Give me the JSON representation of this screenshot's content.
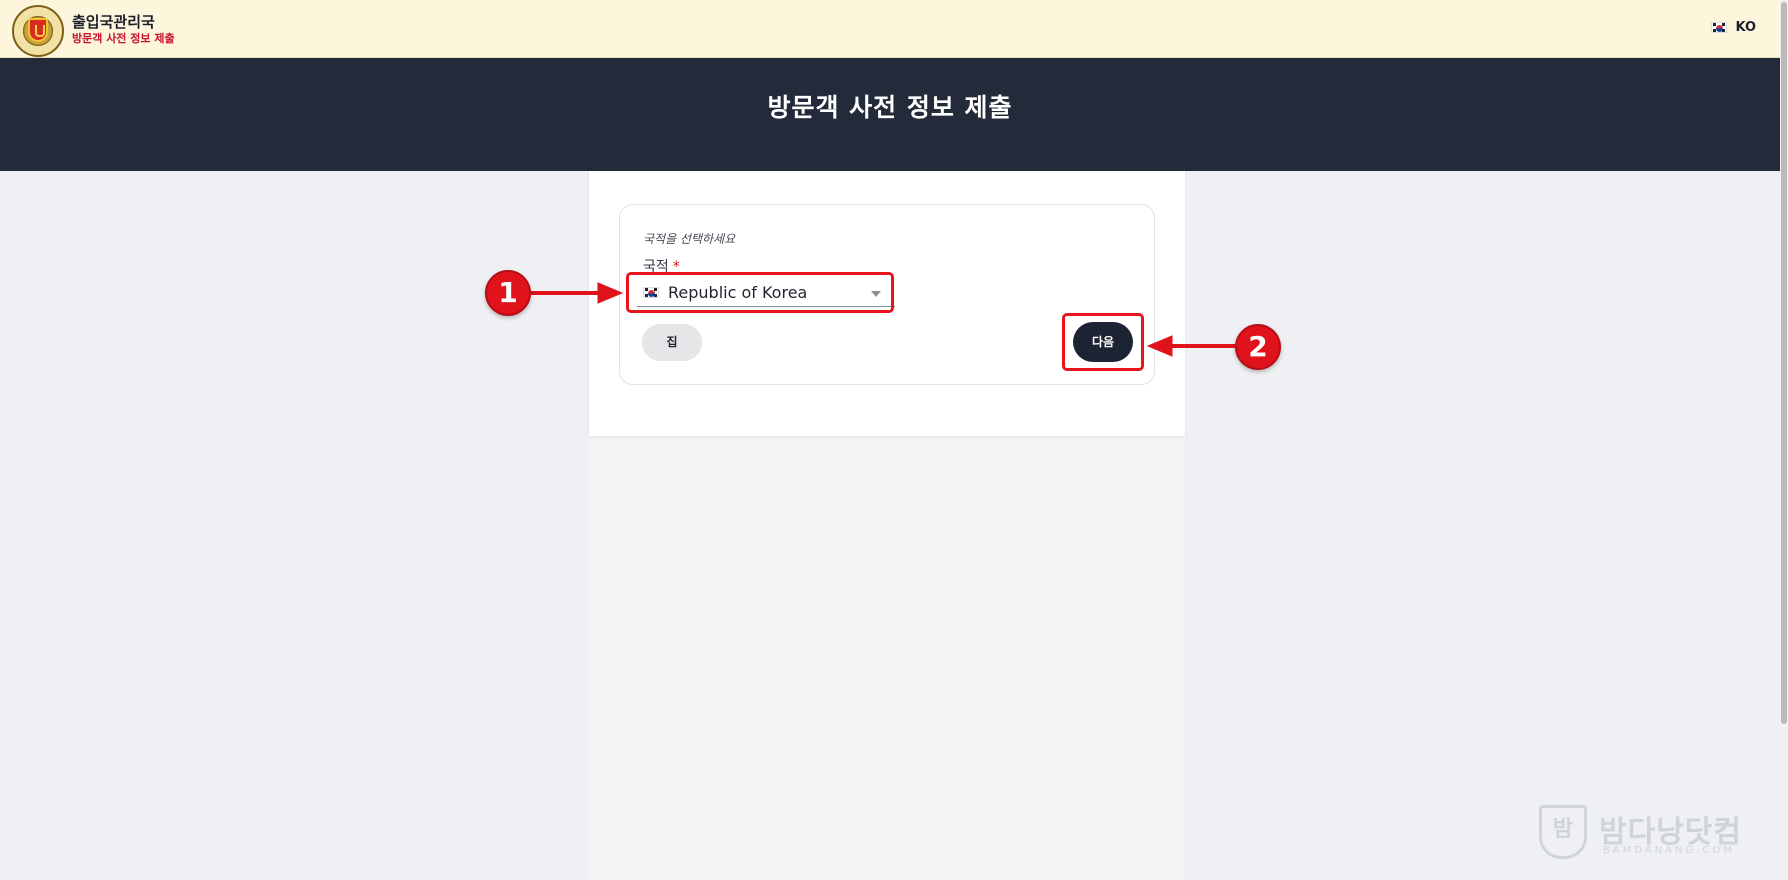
{
  "header": {
    "org_name": "출입국관리국",
    "org_subtitle": "방문객 사전 정보 제출",
    "language_code": "KO",
    "language_flag": "flag-kr-icon"
  },
  "hero": {
    "title": "방문객 사전 정보 제출"
  },
  "form": {
    "hint": "국적을 선택하세요",
    "nationality_label": "국적",
    "required_mark": "*",
    "nationality_value": "Republic of Korea",
    "home_button": "집",
    "next_button": "다음"
  },
  "annotations": {
    "step1": "1",
    "step2": "2",
    "color": "#e0121b"
  },
  "watermark": {
    "glyph": "밤",
    "name": "밤다낭닷컴",
    "url": "BAMDANANG.COM"
  },
  "colors": {
    "topbar_bg": "#fdf6dc",
    "hero_bg": "#232b3b",
    "next_button_bg": "#1c2433",
    "required": "#d7141a"
  }
}
